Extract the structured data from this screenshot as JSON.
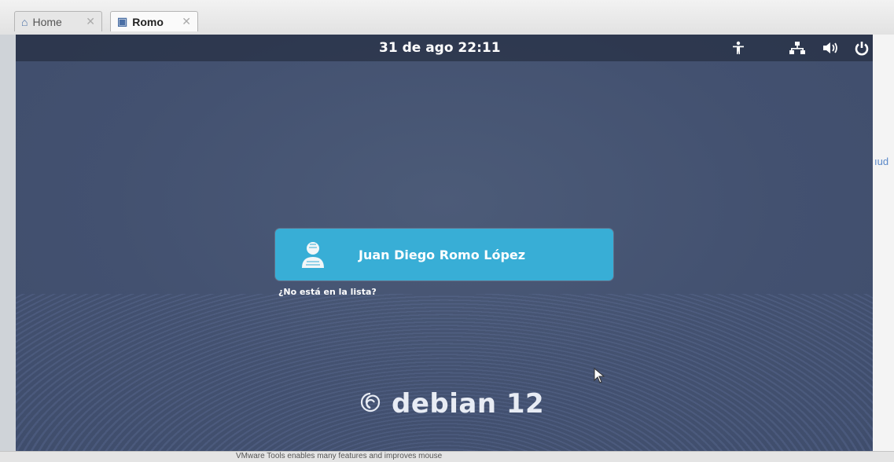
{
  "host": {
    "tabs": [
      {
        "label": "Home",
        "icon": "home-icon"
      },
      {
        "label": "Romo",
        "icon": "vm-icon"
      }
    ],
    "right_edge_text": "ıud",
    "status_text": "VMware Tools enables many features and improves mouse"
  },
  "guest": {
    "clock": "31 de ago  22:11",
    "system_icons": [
      "accessibility-icon",
      "network-icon",
      "volume-icon",
      "power-icon"
    ],
    "user": {
      "name": "Juan Diego Romo López",
      "avatar": "user-avatar-icon",
      "card_color": "#38aed6"
    },
    "not_listed": "¿No está en la lista?",
    "brand": {
      "logo": "debian-swirl-icon",
      "name": "debian 12"
    },
    "background_color": "#435170"
  }
}
